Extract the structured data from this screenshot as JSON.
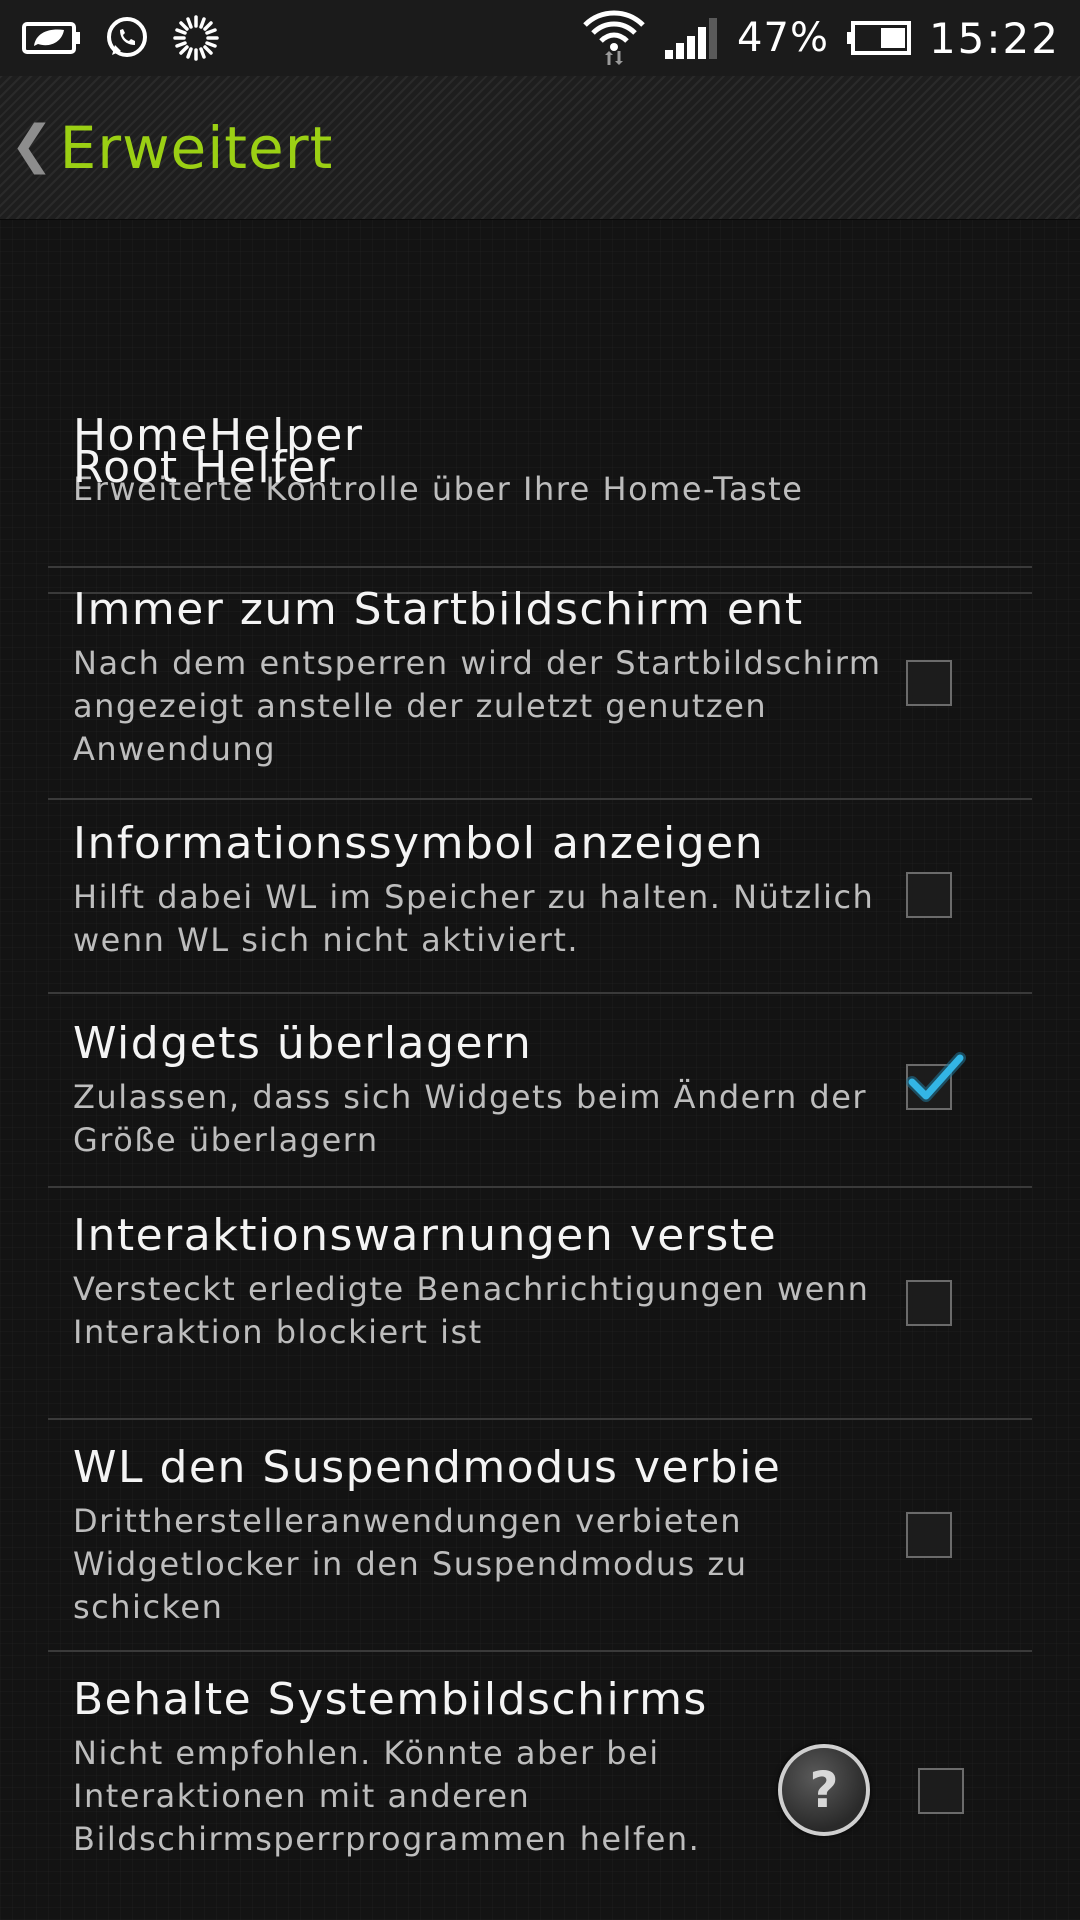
{
  "status_bar": {
    "left_icons": [
      "battery-saver-icon",
      "whatsapp-icon",
      "loading-spinner-icon"
    ],
    "right_icons": [
      "wifi-icon",
      "signal-icon",
      "battery-icon"
    ],
    "battery_percent": "47%",
    "time": "15:22"
  },
  "action_bar": {
    "back_icon": "chevron-left-icon",
    "title": "Erweitert",
    "title_color": "#9bd014"
  },
  "settings": [
    {
      "title": "HomeHelper",
      "summary": "Erweiterte Kontrolle über Ihre Home-Taste"
    },
    {
      "title": "Root Helfer"
    },
    {
      "title": "Immer zum Startbildschirm ent",
      "summary": "Nach dem entsperren wird der Startbildschirm angezeigt anstelle der zuletzt genutzen Anwendung",
      "checked": false
    },
    {
      "title": "Informationssymbol anzeigen",
      "summary": "Hilft dabei WL im Speicher zu halten. Nützlich wenn WL sich nicht aktiviert.",
      "checked": false
    },
    {
      "title": "Widgets überlagern",
      "summary": "Zulassen, dass sich Widgets beim Ändern der Größe überlagern",
      "checked": true
    },
    {
      "title": "Interaktionswarnungen verste",
      "summary": "Versteckt erledigte Benachrichtigungen wenn Interaktion blockiert ist",
      "checked": false
    },
    {
      "title": "WL den Suspendmodus verbie",
      "summary": "Drittherstelleranwendungen verbieten Widgetlocker in den Suspendmodus zu schicken",
      "checked": false
    },
    {
      "title": "Behalte Systembildschirms",
      "summary": "Nicht empfohlen. Könnte aber bei Interaktionen mit anderen Bildschirmsperrprogrammen helfen.",
      "checked": false,
      "help_icon": "help-icon",
      "help_label": "?"
    }
  ],
  "colors": {
    "check_accent": "#33b5e5",
    "divider": "#3a3a3a"
  }
}
